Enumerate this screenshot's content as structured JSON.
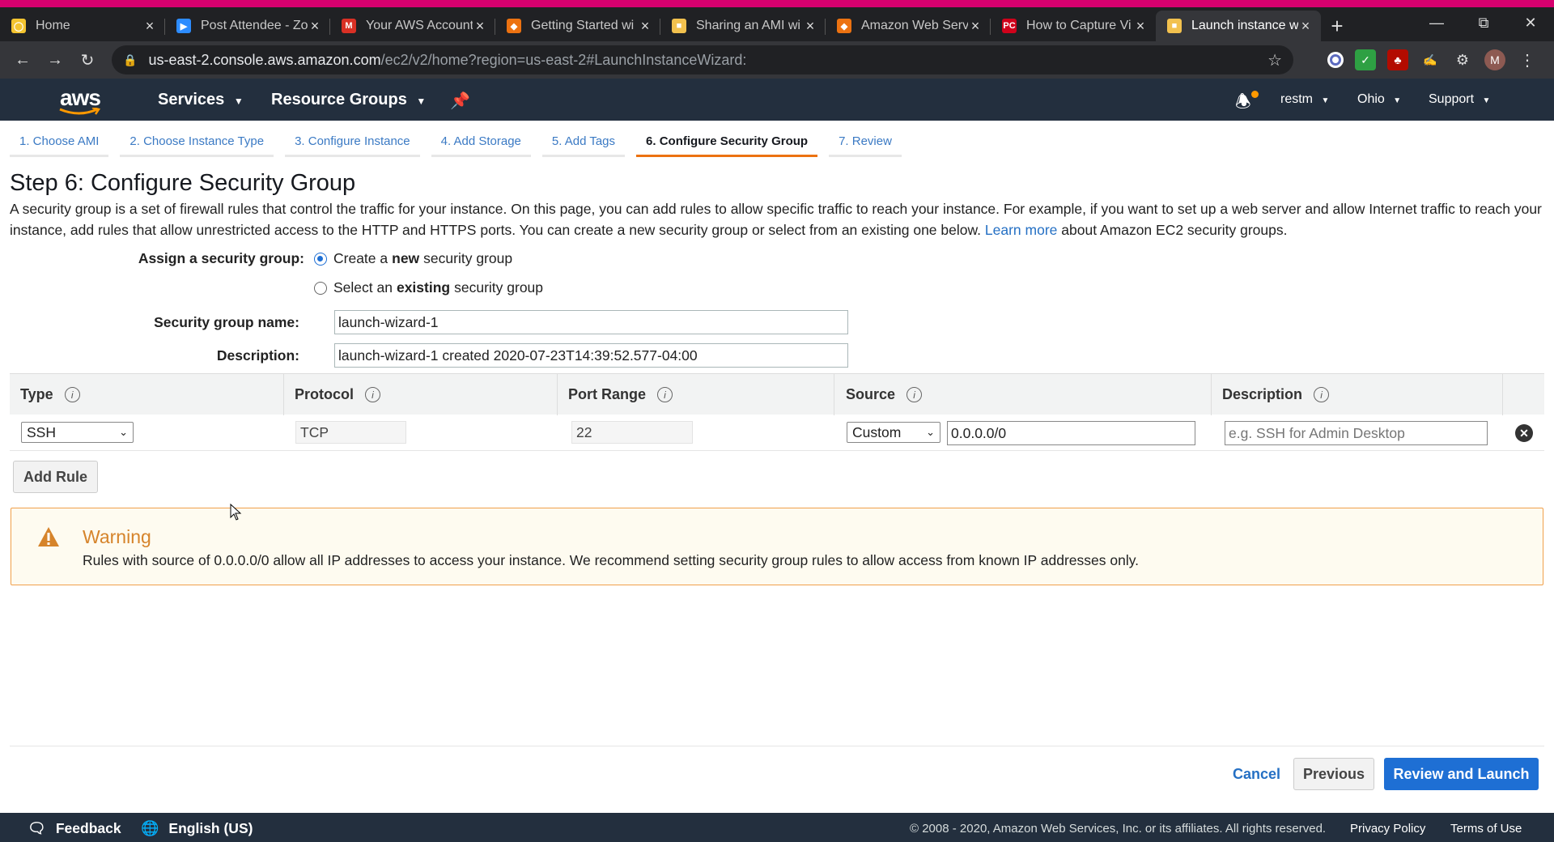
{
  "browser": {
    "tabs": [
      {
        "title": "Home",
        "icon": "zoom-home-icon",
        "color": "#f4c430"
      },
      {
        "title": "Post Attendee - Zo",
        "icon": "zoom-icon",
        "color": "#2d8cff"
      },
      {
        "title": "Your AWS Account",
        "icon": "gmail-icon",
        "color": "#d93025"
      },
      {
        "title": "Getting Started wi",
        "icon": "aws-cube-icon",
        "color": "#ec7211"
      },
      {
        "title": "Sharing an AMI wi",
        "icon": "aws-box-icon",
        "color": "#f2c14e"
      },
      {
        "title": "Amazon Web Serv",
        "icon": "aws-cube-icon",
        "color": "#ec7211"
      },
      {
        "title": "How to Capture Vi",
        "icon": "pc-icon",
        "color": "#d0021b"
      },
      {
        "title": "Launch instance wi",
        "icon": "aws-box-icon",
        "color": "#f2c14e"
      }
    ],
    "url_host": "us-east-2.console.aws.amazon.com",
    "url_path": "/ec2/v2/home?region=us-east-2#LaunchInstanceWizard:",
    "profile_initial": "M"
  },
  "header": {
    "logo": "aws",
    "services": "Services",
    "resource_groups": "Resource Groups",
    "user": "restm",
    "region": "Ohio",
    "support": "Support"
  },
  "steps": [
    "1. Choose AMI",
    "2. Choose Instance Type",
    "3. Configure Instance",
    "4. Add Storage",
    "5. Add Tags",
    "6. Configure Security Group",
    "7. Review"
  ],
  "page": {
    "title": "Step 6: Configure Security Group",
    "intro_before": "A security group is a set of firewall rules that control the traffic for your instance. On this page, you can add rules to allow specific traffic to reach your instance. For example, if you want to set up a web server and allow Internet traffic to reach your instance, add rules that allow unrestricted access to the HTTP and HTTPS ports. You can create a new security group or select from an existing one below.",
    "learn_more": "Learn more",
    "intro_after": "about Amazon EC2 security groups."
  },
  "form": {
    "assign_label": "Assign a security group:",
    "option_create_pre": "Create a",
    "option_create_bold": "new",
    "option_create_post": "security group",
    "option_select_pre": "Select an",
    "option_select_bold": "existing",
    "option_select_post": "security group",
    "name_label": "Security group name:",
    "name_value": "launch-wizard-1",
    "desc_label": "Description:",
    "desc_value": "launch-wizard-1 created 2020-07-23T14:39:52.577-04:00"
  },
  "table": {
    "headers": [
      "Type",
      "Protocol",
      "Port Range",
      "Source",
      "Description"
    ],
    "row": {
      "type": "SSH",
      "protocol": "TCP",
      "port": "22",
      "source_type": "Custom",
      "source_cidr": "0.0.0.0/0",
      "desc_placeholder": "e.g. SSH for Admin Desktop"
    }
  },
  "add_rule": "Add Rule",
  "warning": {
    "title": "Warning",
    "message": "Rules with source of 0.0.0.0/0 allow all IP addresses to access your instance. We recommend setting security group rules to allow access from known IP addresses only."
  },
  "actions": {
    "cancel": "Cancel",
    "previous": "Previous",
    "review": "Review and Launch"
  },
  "footer": {
    "feedback": "Feedback",
    "language": "English (US)",
    "copyright": "© 2008 - 2020, Amazon Web Services, Inc. or its affiliates. All rights reserved.",
    "privacy": "Privacy Policy",
    "terms": "Terms of Use"
  },
  "colors": {
    "aws_nav": "#232f3e",
    "accent_orange": "#ec7211",
    "link_blue": "#2570c4",
    "primary_blue": "#1e6fd4",
    "warning_border": "#f0a04b"
  }
}
